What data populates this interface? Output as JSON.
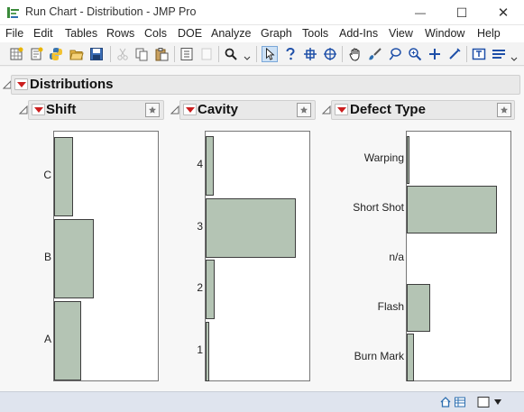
{
  "window": {
    "title": "Run Chart - Distribution - JMP Pro",
    "minimize_glyph": "—",
    "maximize_glyph": "☐",
    "close_glyph": "✕"
  },
  "menu": {
    "items": [
      "File",
      "Edit",
      "Tables",
      "Rows",
      "Cols",
      "DOE",
      "Analyze",
      "Graph",
      "Tools",
      "Add-Ins",
      "View",
      "Window",
      "Help"
    ]
  },
  "report": {
    "title": "Distributions",
    "panels": [
      {
        "title": "Shift",
        "chart_data": {
          "type": "bar",
          "orientation": "horizontal",
          "categories": [
            "C",
            "B",
            "A"
          ],
          "values": [
            0.21,
            0.44,
            0.3
          ]
        }
      },
      {
        "title": "Cavity",
        "chart_data": {
          "type": "bar",
          "orientation": "horizontal",
          "categories": [
            "4",
            "3",
            "2",
            "1"
          ],
          "values": [
            0.09,
            1.0,
            0.1,
            0.04
          ]
        }
      },
      {
        "title": "Defect Type",
        "chart_data": {
          "type": "bar",
          "orientation": "horizontal",
          "categories": [
            "Warping",
            "Short Shot",
            "n/a",
            "Flash",
            "Burn Mark"
          ],
          "values": [
            0.03,
            1.0,
            0.0,
            0.26,
            0.08
          ]
        }
      }
    ]
  },
  "colors": {
    "bar_fill": "#b4c4b4",
    "bar_border": "#3e3e3e",
    "menu_red": "#cc1f1f",
    "status_bar": "#dfe4ee"
  },
  "icons": {
    "toolbar": [
      "new-data-table-icon",
      "new-script-icon",
      "python-icon",
      "open-icon",
      "save-icon",
      "cut-icon",
      "copy-icon",
      "paste-icon",
      "journal-icon",
      "search-icon",
      "arrow-tool-icon",
      "help-tool-icon",
      "crosshair-tool-icon",
      "lasso-target-icon",
      "hand-tool-icon",
      "brush-tool-icon",
      "lasso-tool-icon",
      "zoom-tool-icon",
      "plus-tool-icon",
      "line-tool-icon",
      "annotate-tool-icon",
      "layout-icon"
    ],
    "status": [
      "home-icon",
      "data-table-list-icon",
      "window-icon",
      "dropdown-arrow-icon"
    ]
  }
}
